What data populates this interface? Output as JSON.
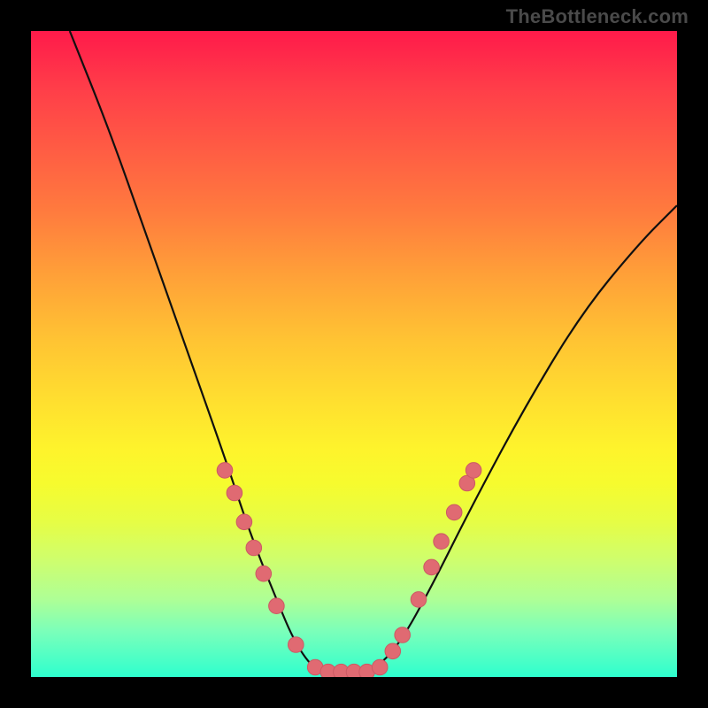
{
  "watermark": "TheBottleneck.com",
  "chart_data": {
    "type": "line",
    "title": "",
    "xlabel": "",
    "ylabel": "",
    "xlim": [
      0,
      100
    ],
    "ylim": [
      0,
      100
    ],
    "grid": false,
    "legend": false,
    "notes": "V-shaped bottleneck curve over a vertical rainbow gradient (red → green). x/y values are read from plot position as percentages of the plotting area.",
    "gradient_stops": [
      {
        "pos": 0,
        "color": "#ff1a4a"
      },
      {
        "pos": 9,
        "color": "#ff3e49"
      },
      {
        "pos": 18,
        "color": "#ff5b44"
      },
      {
        "pos": 28,
        "color": "#ff7b3e"
      },
      {
        "pos": 38,
        "color": "#ffa138"
      },
      {
        "pos": 48,
        "color": "#ffc433"
      },
      {
        "pos": 58,
        "color": "#ffe12f"
      },
      {
        "pos": 65,
        "color": "#fef42c"
      },
      {
        "pos": 70,
        "color": "#f6fb2e"
      },
      {
        "pos": 76,
        "color": "#e6fd45"
      },
      {
        "pos": 82,
        "color": "#cefe6e"
      },
      {
        "pos": 88,
        "color": "#aeff96"
      },
      {
        "pos": 93,
        "color": "#7affba"
      },
      {
        "pos": 100,
        "color": "#2effce"
      }
    ],
    "series": [
      {
        "name": "bottleneck-curve",
        "points": [
          {
            "x": 6,
            "y": 100
          },
          {
            "x": 12,
            "y": 85
          },
          {
            "x": 18,
            "y": 68
          },
          {
            "x": 24,
            "y": 51
          },
          {
            "x": 30,
            "y": 34
          },
          {
            "x": 34,
            "y": 22
          },
          {
            "x": 38,
            "y": 12
          },
          {
            "x": 41,
            "y": 5
          },
          {
            "x": 44,
            "y": 1
          },
          {
            "x": 47,
            "y": 0.5
          },
          {
            "x": 50,
            "y": 0.5
          },
          {
            "x": 53,
            "y": 1
          },
          {
            "x": 57,
            "y": 5
          },
          {
            "x": 62,
            "y": 14
          },
          {
            "x": 68,
            "y": 26
          },
          {
            "x": 76,
            "y": 41
          },
          {
            "x": 85,
            "y": 56
          },
          {
            "x": 94,
            "y": 67
          },
          {
            "x": 100,
            "y": 73
          }
        ]
      }
    ],
    "highlight_points": {
      "color": "#e06a72",
      "radius_pct": 1.2,
      "points": [
        {
          "x": 30.0,
          "y": 32.0
        },
        {
          "x": 31.5,
          "y": 28.5
        },
        {
          "x": 33.0,
          "y": 24.0
        },
        {
          "x": 34.5,
          "y": 20.0
        },
        {
          "x": 36.0,
          "y": 16.0
        },
        {
          "x": 38.0,
          "y": 11.0
        },
        {
          "x": 41.0,
          "y": 5.0
        },
        {
          "x": 44.0,
          "y": 1.5
        },
        {
          "x": 46.0,
          "y": 0.8
        },
        {
          "x": 48.0,
          "y": 0.8
        },
        {
          "x": 50.0,
          "y": 0.8
        },
        {
          "x": 52.0,
          "y": 0.8
        },
        {
          "x": 54.0,
          "y": 1.5
        },
        {
          "x": 56.0,
          "y": 4.0
        },
        {
          "x": 57.5,
          "y": 6.5
        },
        {
          "x": 60.0,
          "y": 12.0
        },
        {
          "x": 62.0,
          "y": 17.0
        },
        {
          "x": 63.5,
          "y": 21.0
        },
        {
          "x": 65.5,
          "y": 25.5
        },
        {
          "x": 67.5,
          "y": 30.0
        },
        {
          "x": 68.5,
          "y": 32.0
        }
      ]
    }
  }
}
